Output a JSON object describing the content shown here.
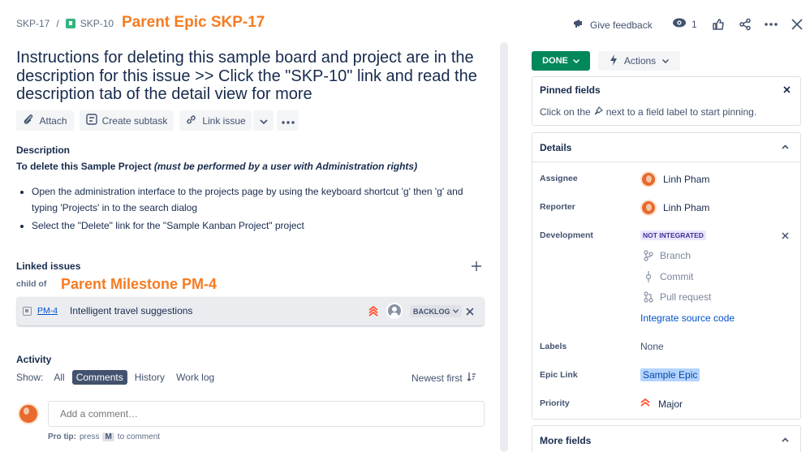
{
  "breadcrumb": {
    "project": "SKP-17",
    "separator": "/",
    "parent": "SKP-10"
  },
  "annotations": {
    "parent_epic": "Parent Epic SKP-17",
    "parent_milestone": "Parent Milestone PM-4"
  },
  "header_actions": {
    "feedback": "Give feedback",
    "watchers": "1"
  },
  "issue": {
    "title_lines": [
      "Instructions for deleting this sample board and project are in the",
      "description for this issue >> Click the \"SKP-10\" link and read the",
      "description tab of the detail view for more"
    ]
  },
  "toolbar": {
    "attach": "Attach",
    "create_subtask": "Create subtask",
    "link_issue": "Link issue"
  },
  "description": {
    "heading": "Description",
    "intro_bold": "To delete this Sample Project",
    "intro_italic": "(must be performed by a user with Administration rights)",
    "bullets": [
      "Open the administration interface to the projects page by using the keyboard shortcut 'g' then 'g' and",
      "typing 'Projects' in to the search dialog",
      "Select the \"Delete\" link for the \"Sample Kanban Project\" project"
    ]
  },
  "linked": {
    "heading": "Linked issues",
    "relation": "child of",
    "issue_key": "PM-4",
    "issue_summary": "Intelligent travel suggestions",
    "status": "BACKLOG"
  },
  "activity": {
    "heading": "Activity",
    "show_label": "Show:",
    "tabs": [
      "All",
      "Comments",
      "History",
      "Work log"
    ],
    "sort": "Newest first",
    "comment_placeholder": "Add a comment…",
    "pro_tip_bold": "Pro tip:",
    "pro_tip_text": "press",
    "pro_tip_key": "M",
    "pro_tip_end": "to comment"
  },
  "sidebar": {
    "status": "DONE",
    "actions": "Actions",
    "pinned_title": "Pinned fields",
    "pinned_hint_pre": "Click on the",
    "pinned_hint_post": "next to a field label to start pinning.",
    "details_title": "Details",
    "assignee_label": "Assignee",
    "assignee": "Linh Pham",
    "reporter_label": "Reporter",
    "reporter": "Linh Pham",
    "development_label": "Development",
    "not_integrated": "NOT INTEGRATED",
    "dev_items": [
      "Branch",
      "Commit",
      "Pull request"
    ],
    "integrate": "Integrate source code",
    "labels_label": "Labels",
    "labels": "None",
    "epic_label": "Epic Link",
    "epic": "Sample Epic",
    "priority_label": "Priority",
    "priority": "Major",
    "more_fields": "More fields"
  },
  "colors": {
    "done_green": "#00875a",
    "link_blue": "#0052cc",
    "annotation_orange": "#f57c22",
    "priority_orange": "#ff5630"
  }
}
